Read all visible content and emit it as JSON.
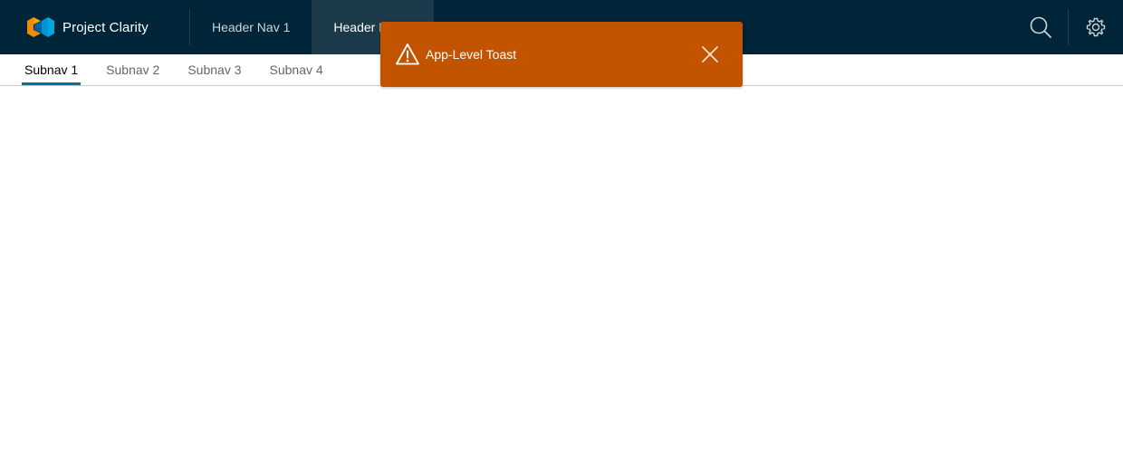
{
  "header": {
    "brand_title": "Project Clarity",
    "nav": [
      {
        "label": "Header Nav 1",
        "active": false
      },
      {
        "label": "Header Nav 2",
        "active": true
      }
    ],
    "actions": [
      {
        "icon": "search-icon"
      },
      {
        "icon": "gear-icon"
      }
    ]
  },
  "subnav": {
    "items": [
      {
        "label": "Subnav 1",
        "active": true
      },
      {
        "label": "Subnav 2",
        "active": false
      },
      {
        "label": "Subnav 3",
        "active": false
      },
      {
        "label": "Subnav 4",
        "active": false
      }
    ]
  },
  "toast": {
    "message": "App-Level Toast",
    "icon": "warning-icon",
    "close_icon": "close-icon"
  },
  "colors": {
    "header_bg": "#002538",
    "toast_bg": "#c25400",
    "active_tab_underline": "#0072a3",
    "logo_orange": "#f38b00",
    "logo_blue": "#0095d3"
  }
}
